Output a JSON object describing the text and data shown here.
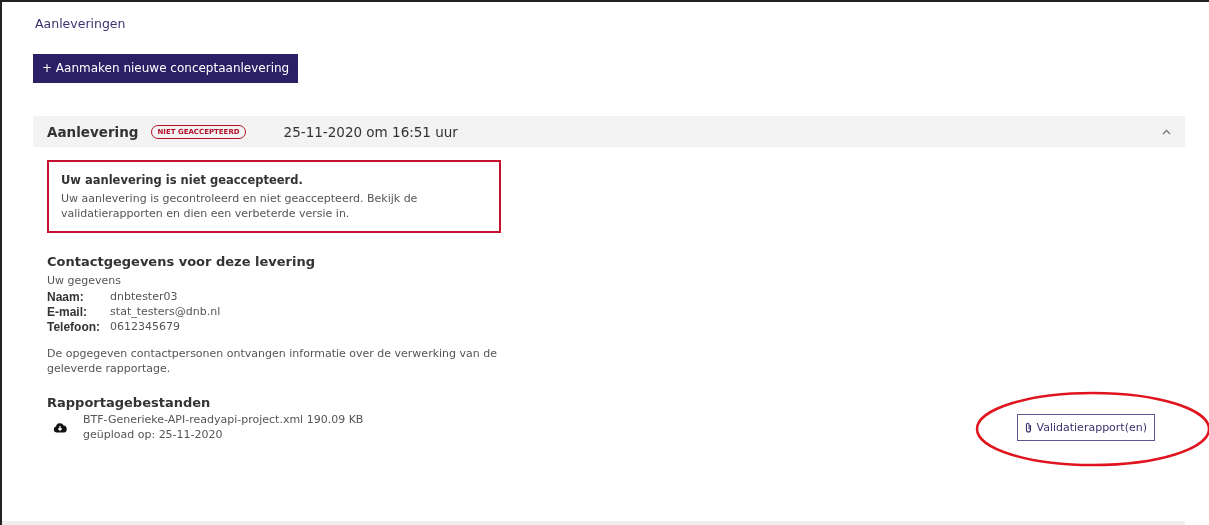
{
  "page_title": "Aanleveringen",
  "create_button": {
    "icon": "+",
    "label": "Aanmaken nieuwe conceptaanlevering"
  },
  "delivery": {
    "title": "Aanlevering",
    "status": "NIET GEACCEPTEERD",
    "datetime": "25-11-2020 om 16:51 uur",
    "expanded": true,
    "alert": {
      "title": "Uw aanlevering is niet geaccepteerd.",
      "text": "Uw aanlevering is gecontroleerd en niet geaccepteerd. Bekijk de validatierapporten en dien een verbeterde versie in."
    },
    "contact": {
      "heading": "Contactgegevens voor deze levering",
      "subheading": "Uw gegevens",
      "fields": [
        {
          "label": "Naam:",
          "value": "dnbtester03"
        },
        {
          "label": "E-mail:",
          "value": "stat_testers@dnb.nl"
        },
        {
          "label": "Telefoon:",
          "value": "0612345679"
        }
      ],
      "note": "De opgegeven contactpersonen ontvangen informatie over de verwerking van de geleverde rapportage."
    },
    "files": {
      "heading": "Rapportagebestanden",
      "items": [
        {
          "name": "BTF-Generieke-API-readyapi-project.xml 190.09 KB",
          "uploaded": "geüpload op: 25-11-2020",
          "button": "Validatierapport(en)",
          "highlighted": true
        }
      ]
    }
  }
}
